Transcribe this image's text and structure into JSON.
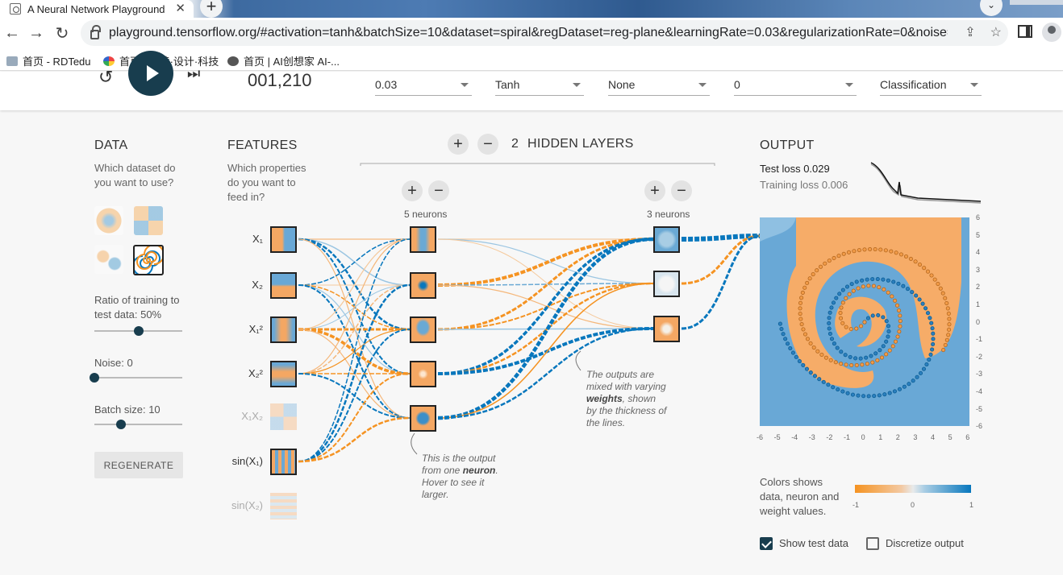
{
  "browser": {
    "tab_title": "A Neural Network Playground",
    "url": "playground.tensorflow.org/#activation=tanh&batchSize=10&dataset=spiral&regDataset=reg-plane&learningRate=0.03&regularizationRate=0&noise=0...",
    "bookmarks": [
      "首页 - RDTedu",
      "首页 | 阅读·设计·科技",
      "首页 | AI创想家 AI-..."
    ]
  },
  "top": {
    "epoch": "001,210",
    "learning_rate": "0.03",
    "activation": "Tanh",
    "regularization": "None",
    "regularization_rate": "0",
    "problem_type": "Classification"
  },
  "data": {
    "title": "DATA",
    "desc": "Which dataset do you want to use?",
    "ratio_label": "Ratio of training to test data:  50%",
    "ratio_value": 0.5,
    "noise_label": "Noise:  0",
    "noise_value": 0,
    "batch_label": "Batch size:  10",
    "batch_value": 0.3,
    "regenerate": "REGENERATE"
  },
  "features": {
    "title": "FEATURES",
    "desc": "Which properties do you want to feed in?",
    "items": [
      {
        "label": "X₁",
        "active": true
      },
      {
        "label": "X₂",
        "active": true
      },
      {
        "label": "X₁²",
        "active": true
      },
      {
        "label": "X₂²",
        "active": true
      },
      {
        "label": "X₁X₂",
        "active": false
      },
      {
        "label": "sin(X₁)",
        "active": true
      },
      {
        "label": "sin(X₂)",
        "active": false
      }
    ]
  },
  "network": {
    "hidden_count": "2",
    "hidden_label": "HIDDEN LAYERS",
    "layer1_label": "5 neurons",
    "layer2_label": "3 neurons",
    "note1": "This is the output from one neuron. Hover to see it larger.",
    "note1_a": "This is the output from one ",
    "note1_b": "neuron",
    "note1_c": ". Hover to see it larger.",
    "note2_a": "The outputs are mixed with varying ",
    "note2_b": "weights",
    "note2_c": ", shown by the thickness of the lines."
  },
  "output": {
    "title": "OUTPUT",
    "test_loss_label": "Test loss",
    "test_loss": "0.029",
    "train_loss_label": "Training loss",
    "train_loss": "0.006",
    "axis_ticks": [
      "-6",
      "-5",
      "-4",
      "-3",
      "-2",
      "-1",
      "0",
      "1",
      "2",
      "3",
      "4",
      "5",
      "6"
    ],
    "colors_desc": "Colors shows data, neuron and weight values.",
    "legend_ticks": [
      "-1",
      "0",
      "1"
    ],
    "show_test_data": "Show test data",
    "discretize": "Discretize output"
  },
  "colors": {
    "orange": "#f59322",
    "blue": "#0877bd",
    "dark": "#183d4e"
  }
}
